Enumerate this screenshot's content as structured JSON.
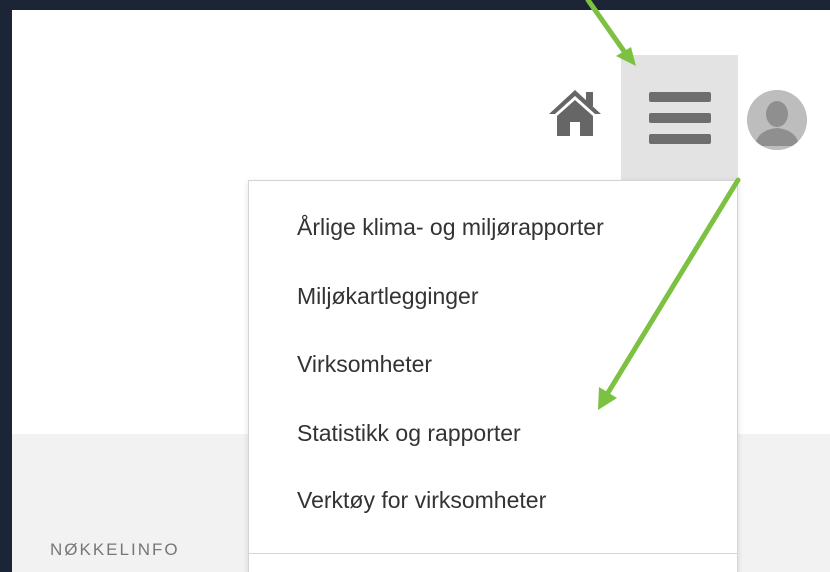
{
  "header": {
    "home_icon": "home-icon",
    "menu_icon": "hamburger-menu-icon",
    "avatar_icon": "user-avatar-icon",
    "menu_active_bg": "#e3e3e3"
  },
  "dropdown": {
    "items": [
      {
        "label": "Årlige klima- og miljørapporter"
      },
      {
        "label": "Miljøkartlegginger"
      },
      {
        "label": "Virksomheter"
      },
      {
        "label": "Statistikk og rapporter"
      },
      {
        "label": "Verktøy for virksomheter"
      }
    ]
  },
  "footer": {
    "section_label": "NØKKELINFO"
  },
  "annotations": {
    "arrow_color": "#7cc142"
  }
}
